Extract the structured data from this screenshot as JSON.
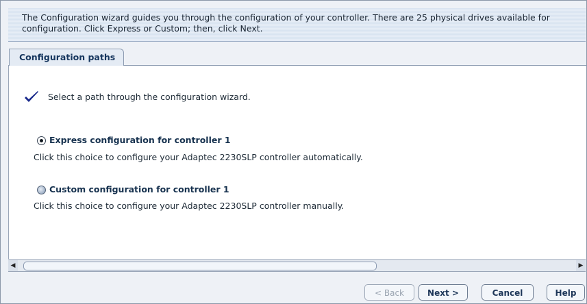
{
  "header": {
    "text": "The Configuration wizard guides you through the configuration of your controller. There are 25 physical drives available for configuration. Click Express or Custom; then, click Next."
  },
  "tab": {
    "label": "Configuration paths"
  },
  "main": {
    "intro": "Select a path through the configuration wizard.",
    "options": [
      {
        "title": "Express configuration for controller 1",
        "description": "Click this choice to configure your Adaptec 2230SLP controller automatically.",
        "selected": true
      },
      {
        "title": "Custom configuration for controller 1",
        "description": "Click this choice to configure your Adaptec 2230SLP controller manually.",
        "selected": false
      }
    ]
  },
  "buttons": {
    "back": "< Back",
    "next": "Next >",
    "cancel": "Cancel",
    "help": "Help"
  },
  "icons": {
    "check": "checkmark-icon",
    "scroll_left": "arrow-left-icon",
    "scroll_right": "arrow-right-icon"
  },
  "colors": {
    "accent": "#16365e",
    "checkmark": "#1a2a8c"
  }
}
